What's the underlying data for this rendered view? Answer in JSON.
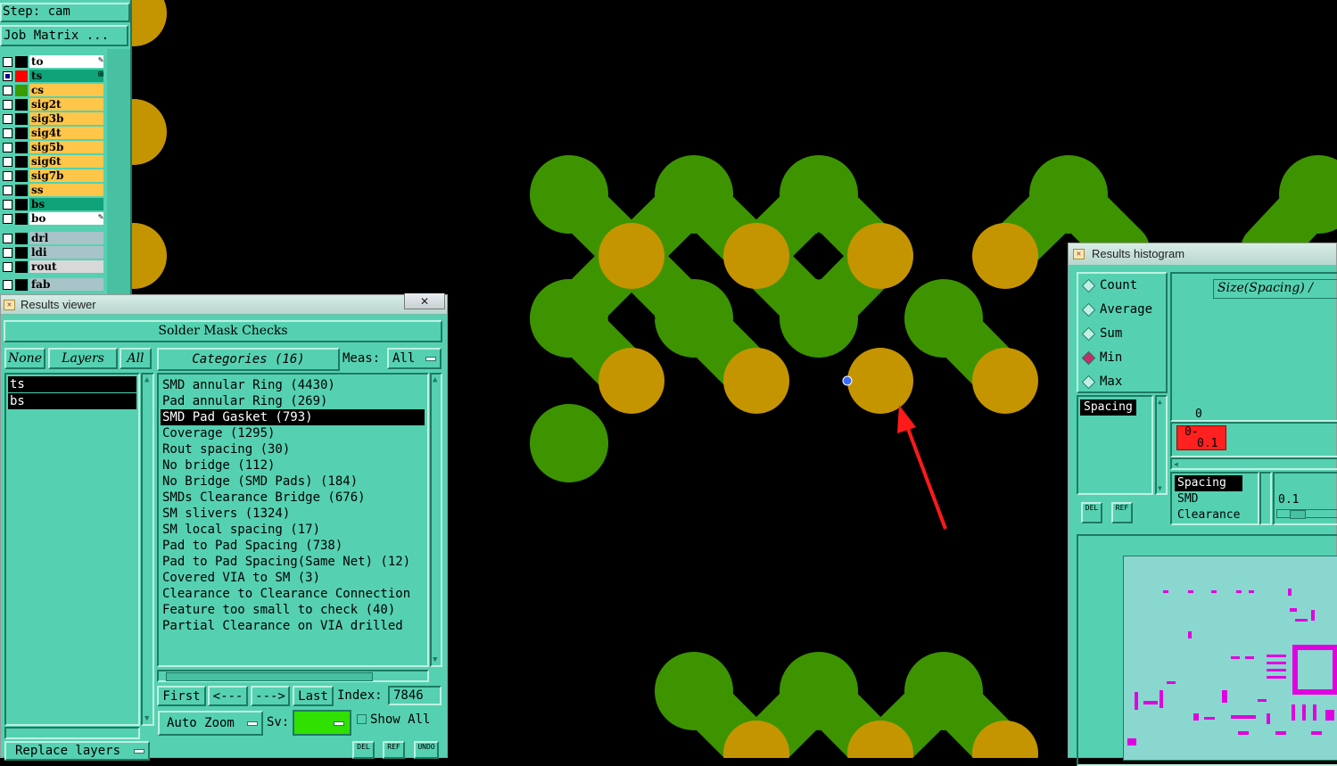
{
  "top": {
    "step_label": "Step: cam",
    "job_matrix_label": "Job Matrix ..."
  },
  "layers": [
    {
      "name": "to",
      "checked": false,
      "swatch": "#000000",
      "fill": "#ffffff",
      "marker": "✎"
    },
    {
      "name": "ts",
      "checked": true,
      "swatch": "#ff0000",
      "fill": "#10a37a",
      "marker": "⊞"
    },
    {
      "name": "cs",
      "checked": false,
      "swatch": "#3a9a00",
      "fill": "#ffc64a",
      "marker": ""
    },
    {
      "name": "sig2t",
      "checked": false,
      "swatch": "#000000",
      "fill": "#ffc64a",
      "marker": ""
    },
    {
      "name": "sig3b",
      "checked": false,
      "swatch": "#000000",
      "fill": "#ffc64a",
      "marker": ""
    },
    {
      "name": "sig4t",
      "checked": false,
      "swatch": "#000000",
      "fill": "#ffc64a",
      "marker": ""
    },
    {
      "name": "sig5b",
      "checked": false,
      "swatch": "#000000",
      "fill": "#ffc64a",
      "marker": ""
    },
    {
      "name": "sig6t",
      "checked": false,
      "swatch": "#000000",
      "fill": "#ffc64a",
      "marker": ""
    },
    {
      "name": "sig7b",
      "checked": false,
      "swatch": "#000000",
      "fill": "#ffc64a",
      "marker": ""
    },
    {
      "name": "ss",
      "checked": false,
      "swatch": "#000000",
      "fill": "#ffc64a",
      "marker": ""
    },
    {
      "name": "bs",
      "checked": false,
      "swatch": "#000000",
      "fill": "#10a37a",
      "marker": ""
    },
    {
      "name": "bo",
      "checked": false,
      "swatch": "#000000",
      "fill": "#ffffff",
      "marker": "✎"
    },
    {
      "name": "drl",
      "checked": false,
      "swatch": "#000000",
      "fill": "#a9c4c8",
      "marker": ""
    },
    {
      "name": "ldi",
      "checked": false,
      "swatch": "#000000",
      "fill": "#a9c4c8",
      "marker": ""
    },
    {
      "name": "rout",
      "checked": false,
      "swatch": "#000000",
      "fill": "#d8d8d8",
      "marker": ""
    },
    {
      "name": "fab",
      "checked": false,
      "swatch": "#000000",
      "fill": "#a9c4c8",
      "marker": ""
    }
  ],
  "viewer": {
    "title": "Results viewer",
    "close_label": "✕",
    "header": "Solder Mask Checks",
    "none_label": "None",
    "layers_label": "Layers",
    "all_label": "All",
    "categories_label": "Categories (16)",
    "meas_label": "Meas:",
    "meas_value": "All",
    "layer_list": [
      "ts",
      "bs"
    ],
    "categories": [
      "SMD annular Ring (4430)",
      "Pad annular Ring (269)",
      "SMD Pad Gasket (793)",
      "Coverage (1295)",
      "Rout spacing (30)",
      "No bridge (112)",
      "No Bridge (SMD Pads) (184)",
      "SMDs Clearance Bridge (676)",
      "SM slivers (1324)",
      "SM local spacing (17)",
      "Pad to Pad Spacing (738)",
      "Pad to Pad Spacing(Same Net) (12)",
      "Covered VIA to SM (3)",
      "Clearance to Clearance Connection",
      "Feature too small to check (40)",
      "Partial Clearance on VIA drilled"
    ],
    "selected_category": "SMD Pad Gasket (793)",
    "first_label": "First",
    "prev_label": "<---",
    "next_label": "--->",
    "last_label": "Last",
    "index_label": "Index:",
    "index_value": "7846",
    "auto_zoom_label": "Auto Zoom",
    "sv_label": "Sv:",
    "show_all_label": "Show All",
    "replace_layers_label": "Replace layers",
    "del_label": "DEL",
    "ref_label": "REF",
    "undo_label": "UNDO"
  },
  "histogram": {
    "title": "Results histogram",
    "stats": [
      "Count",
      "Average",
      "Sum",
      "Min",
      "Max"
    ],
    "selected_stat": "Min",
    "size_label": "Size(Spacing) /",
    "list1": [
      "Spacing"
    ],
    "axis_zero": "0",
    "bin_label_top": "0-",
    "bin_label_bottom": "0.1",
    "list2": [
      "Spacing",
      "SMD",
      "Clearance"
    ],
    "slider_value": "0.1",
    "del_label": "DEL",
    "ref_label": "REF"
  },
  "colors": {
    "panel": "#55d1b1",
    "copper_green": "#3d9400",
    "pad_gold": "#c59500",
    "arrow": "#ff1a1a",
    "bin_red": "#ff2020",
    "magenta": "#e000e0"
  }
}
